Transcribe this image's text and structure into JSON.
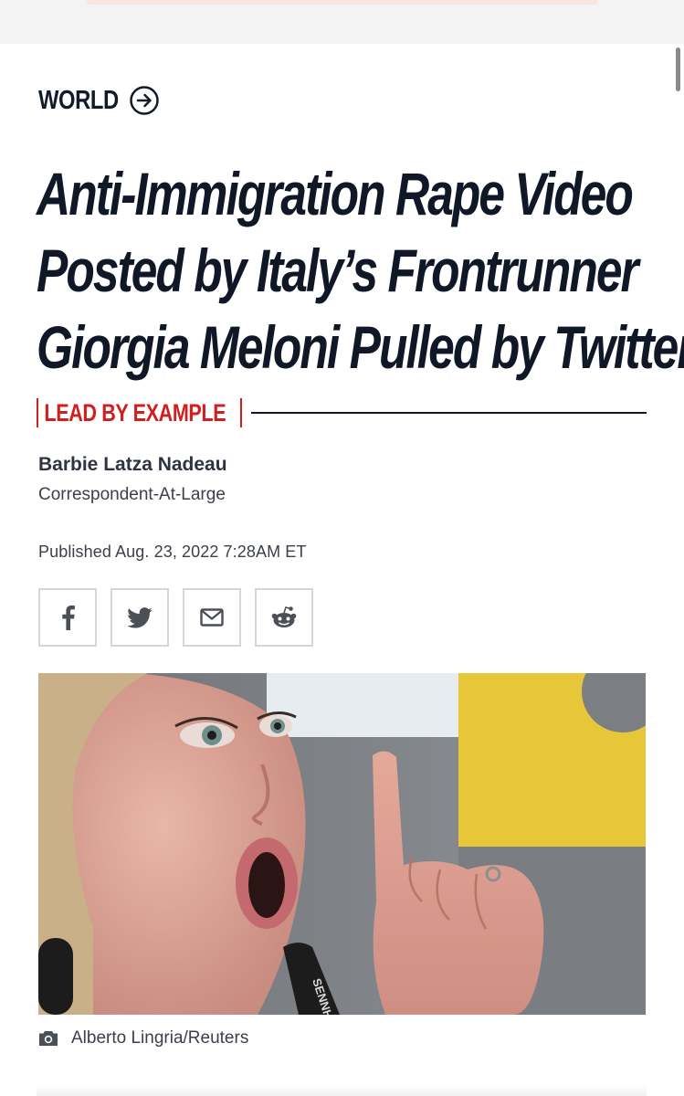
{
  "section": {
    "label": "WORLD",
    "icon": "arrow-circle-right-icon"
  },
  "headline": {
    "lines": [
      "Anti-Immigration Rape Video",
      "Posted by Italy’s Frontrunner",
      "Giorgia Meloni Pulled by Twitter"
    ]
  },
  "rubric": {
    "label": "LEAD BY EXAMPLE",
    "color": "#d11f1f"
  },
  "byline": {
    "author": "Barbie Latza Nadeau",
    "role": "Correspondent-At-Large"
  },
  "published": "Published Aug. 23, 2022 7:28AM ET",
  "share": [
    {
      "icon": "facebook-icon"
    },
    {
      "icon": "twitter-icon"
    },
    {
      "icon": "email-icon"
    },
    {
      "icon": "reddit-icon"
    }
  ],
  "hero_image": {
    "subject": "woman-speaking-at-microphones-with-raised-finger",
    "microphone_brand": "SENNHEI"
  },
  "caption": {
    "icon": "camera-icon",
    "credit": "Alberto Lingria/Reuters"
  },
  "colors": {
    "ink": "#101828",
    "accent": "#d11f1f",
    "border": "#d6d6d6"
  }
}
